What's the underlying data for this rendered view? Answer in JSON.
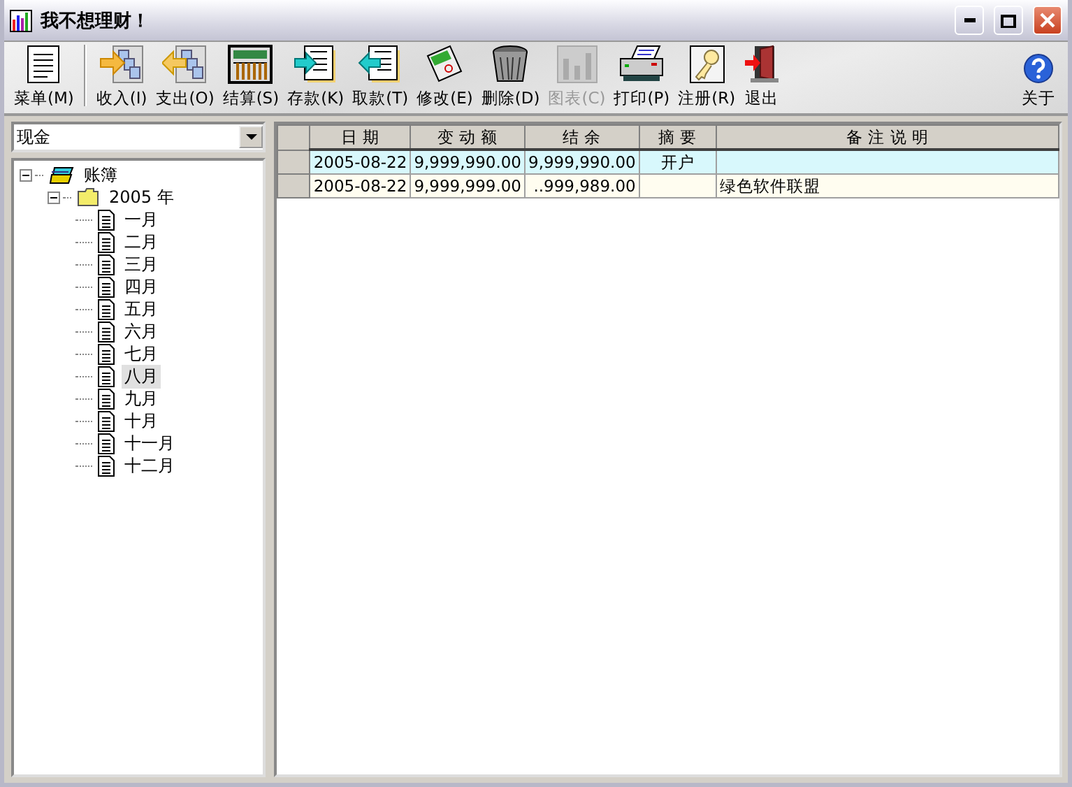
{
  "window": {
    "title": "我不想理财！"
  },
  "toolbar": [
    {
      "kind": "menu",
      "label": "菜单(M)",
      "disabled": false
    },
    {
      "kind": "income",
      "label": "收入(I)",
      "disabled": false
    },
    {
      "kind": "expense",
      "label": "支出(O)",
      "disabled": false
    },
    {
      "kind": "settle",
      "label": "结算(S)",
      "disabled": false
    },
    {
      "kind": "deposit",
      "label": "存款(K)",
      "disabled": false
    },
    {
      "kind": "withdraw",
      "label": "取款(T)",
      "disabled": false
    },
    {
      "kind": "edit",
      "label": "修改(E)",
      "disabled": false
    },
    {
      "kind": "delete",
      "label": "删除(D)",
      "disabled": false
    },
    {
      "kind": "chart",
      "label": "图表(C)",
      "disabled": true
    },
    {
      "kind": "print",
      "label": "打印(P)",
      "disabled": false
    },
    {
      "kind": "register",
      "label": "注册(R)",
      "disabled": false
    },
    {
      "kind": "exit",
      "label": "退出",
      "disabled": false
    },
    {
      "kind": "about",
      "label": "关于",
      "disabled": false
    }
  ],
  "account_select": {
    "value": "现金"
  },
  "tree": [
    {
      "kind": "book",
      "label": "账簿",
      "expanded": true,
      "selected": false,
      "children": [
        {
          "kind": "folder",
          "label": "2005 年",
          "expanded": true,
          "selected": false,
          "children": [
            {
              "kind": "doc",
              "label": "一月",
              "selected": false
            },
            {
              "kind": "doc",
              "label": "二月",
              "selected": false
            },
            {
              "kind": "doc",
              "label": "三月",
              "selected": false
            },
            {
              "kind": "doc",
              "label": "四月",
              "selected": false
            },
            {
              "kind": "doc",
              "label": "五月",
              "selected": false
            },
            {
              "kind": "doc",
              "label": "六月",
              "selected": false
            },
            {
              "kind": "doc",
              "label": "七月",
              "selected": false
            },
            {
              "kind": "doc",
              "label": "八月",
              "selected": true
            },
            {
              "kind": "doc",
              "label": "九月",
              "selected": false
            },
            {
              "kind": "doc",
              "label": "十月",
              "selected": false
            },
            {
              "kind": "doc",
              "label": "十一月",
              "selected": false
            },
            {
              "kind": "doc",
              "label": "十二月",
              "selected": false
            }
          ]
        }
      ]
    }
  ],
  "table": {
    "columns": [
      "日 期",
      "变 动 额",
      "结 余",
      "摘 要",
      "备 注 说 明"
    ],
    "rows": [
      {
        "selected": true,
        "cells": [
          "2005-08-22",
          "9,999,990.00",
          "9,999,990.00",
          "开户",
          ""
        ]
      },
      {
        "selected": false,
        "cells": [
          "2005-08-22",
          "9,999,999.00",
          "..999,989.00",
          "",
          "绿色软件联盟"
        ]
      }
    ]
  }
}
